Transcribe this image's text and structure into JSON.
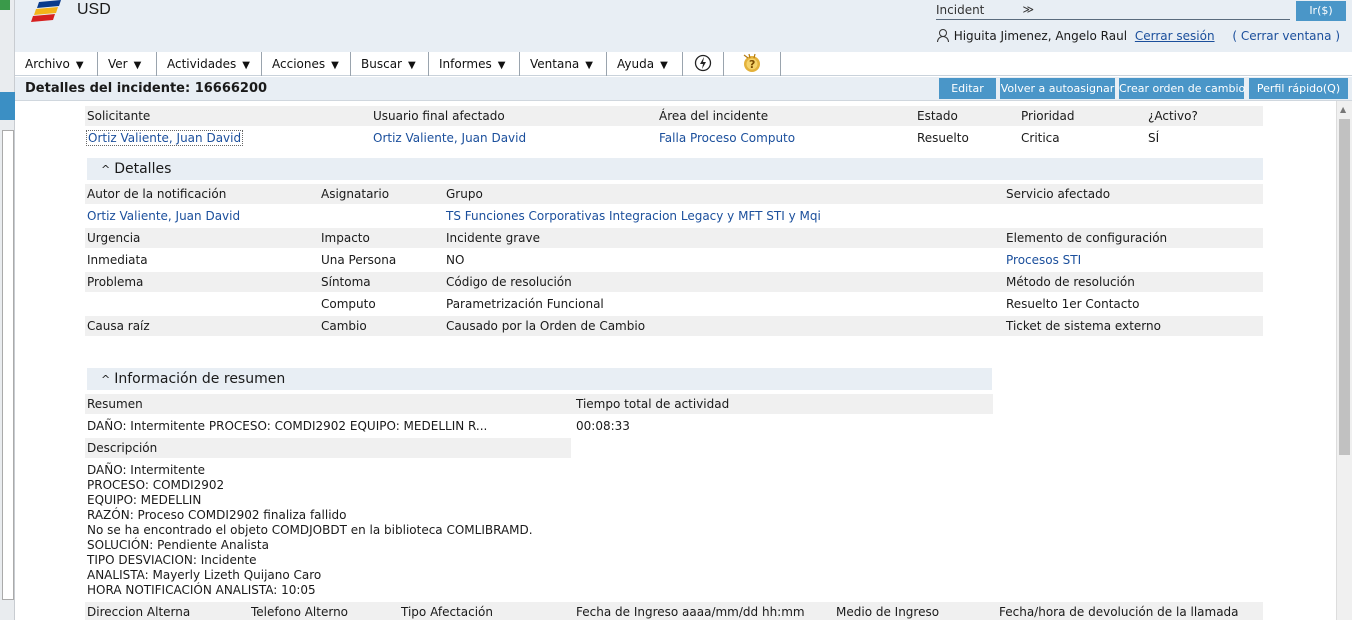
{
  "header": {
    "app_name": "USD",
    "search_type": "Incident",
    "search_value": "",
    "go_label": "Ir($)",
    "user_name": "Higuita Jimenez, Angelo Raul",
    "logout": "Cerrar sesión",
    "close_window": "( Cerrar ventana )"
  },
  "menu": [
    {
      "label": "Archivo"
    },
    {
      "label": "Ver"
    },
    {
      "label": "Actividades"
    },
    {
      "label": "Acciones"
    },
    {
      "label": "Buscar"
    },
    {
      "label": "Informes"
    },
    {
      "label": "Ventana"
    },
    {
      "label": "Ayuda"
    }
  ],
  "toolbar": {
    "title": "Detalles del incidente: 16666200",
    "edit": "Editar",
    "reassign": "Volver a autoasignar",
    "create_change": "Crear orden de cambio",
    "quick_profile": "Perfil rápido(Q)"
  },
  "top_fields": {
    "solicitante_label": "Solicitante",
    "solicitante": "Ortiz Valiente, Juan David",
    "usuario_label": "Usuario final afectado",
    "usuario": "Ortiz Valiente, Juan David",
    "area_label": "Área del incidente",
    "area": "Falla Proceso Computo",
    "estado_label": "Estado",
    "estado": "Resuelto",
    "prioridad_label": "Prioridad",
    "prioridad": "Critica",
    "activo_label": "¿Activo?",
    "activo": "SÍ"
  },
  "detalles": {
    "heading": "Detalles",
    "autor_label": "Autor de la notificación",
    "autor": "Ortiz Valiente, Juan David",
    "asignatario_label": "Asignatario",
    "asignatario": "",
    "grupo_label": "Grupo",
    "grupo": "TS Funciones Corporativas Integracion Legacy y MFT STI y Mqi",
    "servicio_label": "Servicio afectado",
    "servicio": "",
    "urgencia_label": "Urgencia",
    "urgencia": "Inmediata",
    "impacto_label": "Impacto",
    "impacto": "Una Persona",
    "grave_label": "Incidente grave",
    "grave": "NO",
    "elemento_label": "Elemento de configuración",
    "elemento": "Procesos STI",
    "problema_label": "Problema",
    "problema": "",
    "sintoma_label": "Síntoma",
    "sintoma": "Computo",
    "codigo_label": "Código de resolución",
    "codigo": "Parametrización Funcional",
    "metodo_label": "Método de resolución",
    "metodo": "Resuelto 1er Contacto",
    "causa_label": "Causa raíz",
    "cambio_label": "Cambio",
    "causado_label": "Causado por la Orden de Cambio",
    "ticket_label": "Ticket de sistema externo"
  },
  "resumen": {
    "heading": "Información de resumen",
    "resumen_label": "Resumen",
    "resumen": "DAÑO: Intermitente PROCESO: COMDI2902 EQUIPO: MEDELLIN R...",
    "tiempo_label": "Tiempo total de actividad",
    "tiempo": "00:08:33",
    "descripcion_label": "Descripción",
    "descripcion": [
      "DAÑO: Intermitente",
      "PROCESO: COMDI2902",
      "EQUIPO: MEDELLIN",
      "RAZÓN: Proceso COMDI2902 finaliza fallido",
      "No se ha encontrado el objeto COMDJOBDT en la biblioteca COMLIBRAMD.",
      "SOLUCIÓN: Pendiente Analista",
      "TIPO DESVIACION: Incidente",
      "ANALISTA: Mayerly Lizeth Quijano Caro",
      "HORA NOTIFICACIÓN ANALISTA: 10:05"
    ]
  },
  "bottom_labels": {
    "direccion": "Direccion Alterna",
    "telefono": "Telefono Alterno",
    "tipo": "Tipo Afectación",
    "fecha": "Fecha de Ingreso aaaa/mm/dd hh:mm",
    "medio": "Medio de Ingreso",
    "devolucion": "Fecha/hora de devolución de la llamada"
  }
}
